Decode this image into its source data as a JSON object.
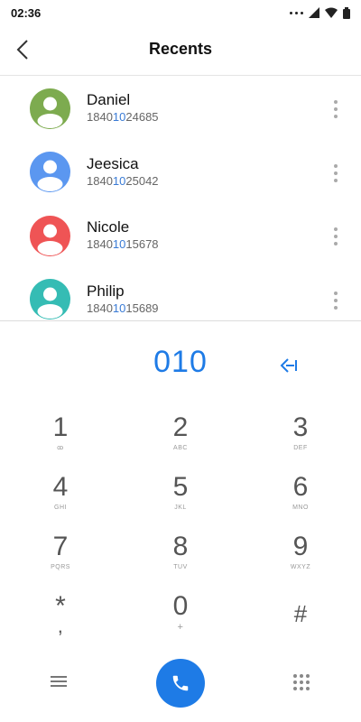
{
  "status": {
    "time": "02:36"
  },
  "header": {
    "title": "Recents"
  },
  "contacts": [
    {
      "name": "Daniel",
      "num_pre": "1840",
      "num_hl": "10",
      "num_post": "24685",
      "color": "#7dab4f"
    },
    {
      "name": "Jeesica",
      "num_pre": "1840",
      "num_hl": "10",
      "num_post": "25042",
      "color": "#5b97f0"
    },
    {
      "name": "Nicole",
      "num_pre": "1840",
      "num_hl": "10",
      "num_post": "15678",
      "color": "#ef5455"
    },
    {
      "name": "Philip",
      "num_pre": "1840",
      "num_hl": "10",
      "num_post": "15689",
      "color": "#35bcb4"
    }
  ],
  "dialer": {
    "input": "010"
  },
  "keys": [
    {
      "digit": "1",
      "letters": "ꝏ"
    },
    {
      "digit": "2",
      "letters": "ABC"
    },
    {
      "digit": "3",
      "letters": "DEF"
    },
    {
      "digit": "4",
      "letters": "GHI"
    },
    {
      "digit": "5",
      "letters": "JKL"
    },
    {
      "digit": "6",
      "letters": "MNO"
    },
    {
      "digit": "7",
      "letters": "PQRS"
    },
    {
      "digit": "8",
      "letters": "TUV"
    },
    {
      "digit": "9",
      "letters": "WXYZ"
    },
    {
      "digit": "*",
      "letters": ","
    },
    {
      "digit": "0",
      "letters": "+"
    },
    {
      "digit": "#",
      "letters": ""
    }
  ],
  "colors": {
    "accent": "#1e7be6"
  },
  "icons": {
    "back": "chevron-left-icon",
    "backspace": "backspace-icon",
    "call": "phone-icon",
    "menu": "menu-icon",
    "keypad": "dialpad-icon"
  }
}
